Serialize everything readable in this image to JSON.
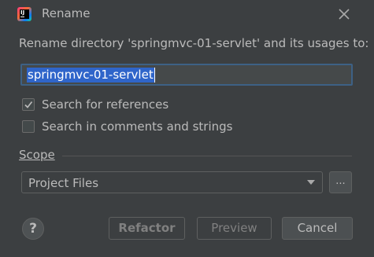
{
  "window": {
    "title": "Rename",
    "app_icon": "intellij-idea-icon",
    "app_icon_text": "IJ"
  },
  "dialog": {
    "prompt": "Rename directory 'springmvc-01-servlet' and its usages to:",
    "new_name_value": "springmvc-01-servlet",
    "options": [
      {
        "label": "Search for references",
        "checked": true
      },
      {
        "label": "Search in comments and strings",
        "checked": false
      }
    ],
    "scope": {
      "label": "Scope",
      "selected": "Project Files",
      "browse_label": "..."
    }
  },
  "footer": {
    "help_label": "?",
    "refactor_label": "Refactor",
    "preview_label": "Preview",
    "cancel_label": "Cancel"
  },
  "colors": {
    "background": "#3c3f41",
    "text": "#bbbbbb",
    "selection": "#2f65ca",
    "focus_border": "#3d6185",
    "disabled_text": "#808080"
  }
}
